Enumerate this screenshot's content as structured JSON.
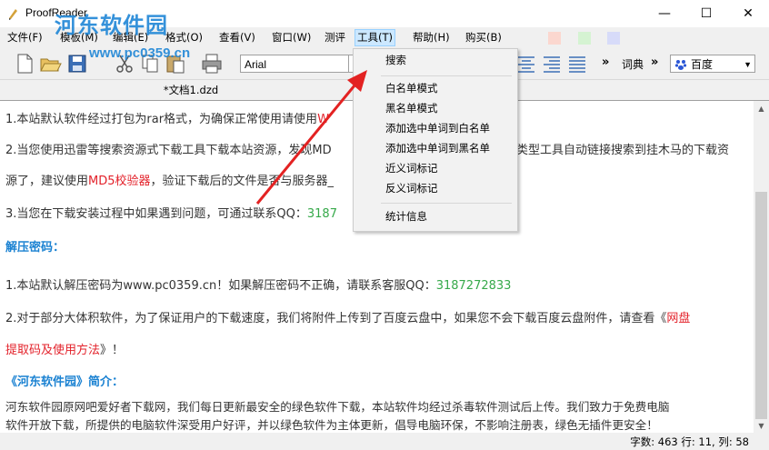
{
  "window": {
    "title": "ProofReader",
    "minimize": "—",
    "maximize": "☐",
    "close": "✕"
  },
  "watermark": {
    "site_name": "河东软件园",
    "site_url": "www.pc0359.cn"
  },
  "menu": {
    "items": [
      "文件(F)",
      "模板(M)",
      "编辑(E)",
      "格式(O)",
      "查看(V)",
      "窗口(W)",
      "测评",
      "工具(T)",
      "帮助(H)",
      "购买(B)"
    ],
    "active": "工具(T)"
  },
  "toolbar": {
    "font": "Arial",
    "dict_label": "词典",
    "search_engine": "百度",
    "overflow": "»",
    "colors": [
      "#fbd7cf",
      "#d5f3d2",
      "#d7dbf9"
    ]
  },
  "tab": {
    "label": "*文档1.dzd"
  },
  "tools_menu": {
    "items": [
      "搜索",
      "白名单模式",
      "黑名单模式",
      "添加选中单词到白名单",
      "添加选中单词到黑名单",
      "近义词标记",
      "反义词标记",
      "统计信息"
    ]
  },
  "document": {
    "p1_a": "1.本站默认软件经过打包为rar格式，为确保正常使用请使用",
    "p1_b": "W",
    "p2_a": "2.当您使用迅雷等搜索资源式下载工具下载本站资源，发现MD",
    "p2_b": "类型工具自动链接搜索到挂木马的下载资",
    "p3_a": "源了，建议使用",
    "p3_b": "MD5校验器",
    "p3_c": "，验证下载后的文件是否与服务器_",
    "p4_a": "3.当您在下载安装过程中如果遇到问题，可通过联系QQ：",
    "p4_b": "3187",
    "h1": "解压密码：",
    "p5_a": "1.本站默认解压密码为www.pc0359.cn！如果解压密码不正确，请联系客服QQ：",
    "p5_b": "3187272833",
    "p6_a": "2.对于部分大体积软件，为了保证用户的下载速度，我们将附件上传到了百度云盘中，如果您不会下载百度云盘附件，请查看《",
    "p6_b": "网盘",
    "p7_a": "提取码及使用方法",
    "p7_b": "》！",
    "h2": "《河东软件园》简介：",
    "p8": "河东软件园原网吧爱好者下载网，我们每日更新最安全的绿色软件下载，本站软件均经过杀毒软件测试后上传。我们致力于免费电脑",
    "p9": "软件开放下载，所提供的电脑软件深受用户好评，并以绿色软件为主体更新，倡导电脑环保，不影响注册表，绿色无插件更安全！"
  },
  "status": {
    "text": "字数: 463 行: 11, 列: 58"
  }
}
